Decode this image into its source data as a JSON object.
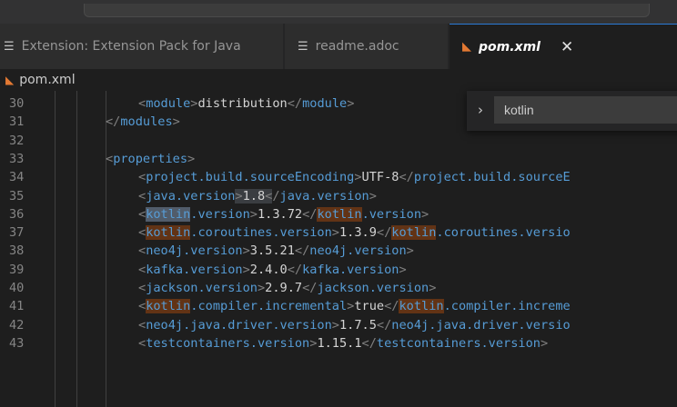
{
  "tabs": [
    {
      "label": "Extension: Extension Pack for Java",
      "icon": "preview-lines-icon"
    },
    {
      "label": "readme.adoc",
      "icon": "preview-lines-icon"
    },
    {
      "label": "pom.xml",
      "icon": "rss-xml-icon",
      "active": true
    }
  ],
  "breadcrumb": {
    "file": "pom.xml"
  },
  "find": {
    "query": "kotlin"
  },
  "colors": {
    "tag": "#569cd6",
    "match": "#623315",
    "accent": "#2a7ad5"
  },
  "lines": [
    {
      "n": "30",
      "indent": 2,
      "parts": [
        [
          "<",
          "br"
        ],
        [
          "module",
          "tag"
        ],
        [
          ">",
          "br"
        ],
        [
          "distribution",
          "txt"
        ],
        [
          "</",
          "br"
        ],
        [
          "module",
          "tag"
        ],
        [
          ">",
          "br"
        ]
      ]
    },
    {
      "n": "31",
      "indent": 1,
      "parts": [
        [
          "</",
          "br"
        ],
        [
          "modules",
          "tag"
        ],
        [
          ">",
          "br"
        ]
      ]
    },
    {
      "n": "32",
      "indent": 0,
      "parts": []
    },
    {
      "n": "33",
      "indent": 1,
      "parts": [
        [
          "<",
          "br"
        ],
        [
          "properties",
          "tag"
        ],
        [
          ">",
          "br"
        ]
      ]
    },
    {
      "n": "34",
      "indent": 2,
      "parts": [
        [
          "<",
          "br"
        ],
        [
          "project.build.sourceEncoding",
          "tag"
        ],
        [
          ">",
          "br"
        ],
        [
          "UTF-8",
          "txt"
        ],
        [
          "</",
          "br"
        ],
        [
          "project.build.sourceE",
          "tag"
        ]
      ]
    },
    {
      "n": "35",
      "indent": 2,
      "parts": [
        [
          "<",
          "br"
        ],
        [
          "java.version",
          "tag"
        ],
        [
          ">",
          "mkbr"
        ],
        [
          "1.8",
          "mk"
        ],
        [
          "<",
          "mkbr"
        ],
        [
          "/",
          "br"
        ],
        [
          "java.version",
          "tag"
        ],
        [
          ">",
          "br"
        ]
      ]
    },
    {
      "n": "36",
      "indent": 2,
      "parts": [
        [
          "<",
          "br"
        ],
        [
          "kotlin",
          "hlcur"
        ],
        [
          ".version",
          "tag"
        ],
        [
          ">",
          "br"
        ],
        [
          "1.3.72",
          "txt"
        ],
        [
          "</",
          "br"
        ],
        [
          "kotlin",
          "hl"
        ],
        [
          ".version",
          "tag"
        ],
        [
          ">",
          "br"
        ]
      ]
    },
    {
      "n": "37",
      "indent": 2,
      "parts": [
        [
          "<",
          "br"
        ],
        [
          "kotlin",
          "hl"
        ],
        [
          ".coroutines.version",
          "tag"
        ],
        [
          ">",
          "br"
        ],
        [
          "1.3.9",
          "txt"
        ],
        [
          "</",
          "br"
        ],
        [
          "kotlin",
          "hl"
        ],
        [
          ".coroutines.versio",
          "tag"
        ]
      ]
    },
    {
      "n": "38",
      "indent": 2,
      "parts": [
        [
          "<",
          "br"
        ],
        [
          "neo4j.version",
          "tag"
        ],
        [
          ">",
          "br"
        ],
        [
          "3.5.21",
          "txt"
        ],
        [
          "</",
          "br"
        ],
        [
          "neo4j.version",
          "tag"
        ],
        [
          ">",
          "br"
        ]
      ]
    },
    {
      "n": "39",
      "indent": 2,
      "parts": [
        [
          "<",
          "br"
        ],
        [
          "kafka.version",
          "tag"
        ],
        [
          ">",
          "br"
        ],
        [
          "2.4.0",
          "txt"
        ],
        [
          "</",
          "br"
        ],
        [
          "kafka.version",
          "tag"
        ],
        [
          ">",
          "br"
        ]
      ]
    },
    {
      "n": "40",
      "indent": 2,
      "parts": [
        [
          "<",
          "br"
        ],
        [
          "jackson.version",
          "tag"
        ],
        [
          ">",
          "br"
        ],
        [
          "2.9.7",
          "txt"
        ],
        [
          "</",
          "br"
        ],
        [
          "jackson.version",
          "tag"
        ],
        [
          ">",
          "br"
        ]
      ]
    },
    {
      "n": "41",
      "indent": 2,
      "parts": [
        [
          "<",
          "br"
        ],
        [
          "kotlin",
          "hl"
        ],
        [
          ".compiler.incremental",
          "tag"
        ],
        [
          ">",
          "br"
        ],
        [
          "true",
          "txt"
        ],
        [
          "</",
          "br"
        ],
        [
          "kotlin",
          "hl"
        ],
        [
          ".compiler.increme",
          "tag"
        ]
      ]
    },
    {
      "n": "42",
      "indent": 2,
      "parts": [
        [
          "<",
          "br"
        ],
        [
          "neo4j.java.driver.version",
          "tag"
        ],
        [
          ">",
          "br"
        ],
        [
          "1.7.5",
          "txt"
        ],
        [
          "</",
          "br"
        ],
        [
          "neo4j.java.driver.versio",
          "tag"
        ]
      ]
    },
    {
      "n": "43",
      "indent": 2,
      "parts": [
        [
          "<",
          "br"
        ],
        [
          "testcontainers.version",
          "tag"
        ],
        [
          ">",
          "br"
        ],
        [
          "1.15.1",
          "txt"
        ],
        [
          "</",
          "br"
        ],
        [
          "testcontainers.version",
          "tag"
        ],
        [
          ">",
          "br"
        ]
      ]
    }
  ]
}
